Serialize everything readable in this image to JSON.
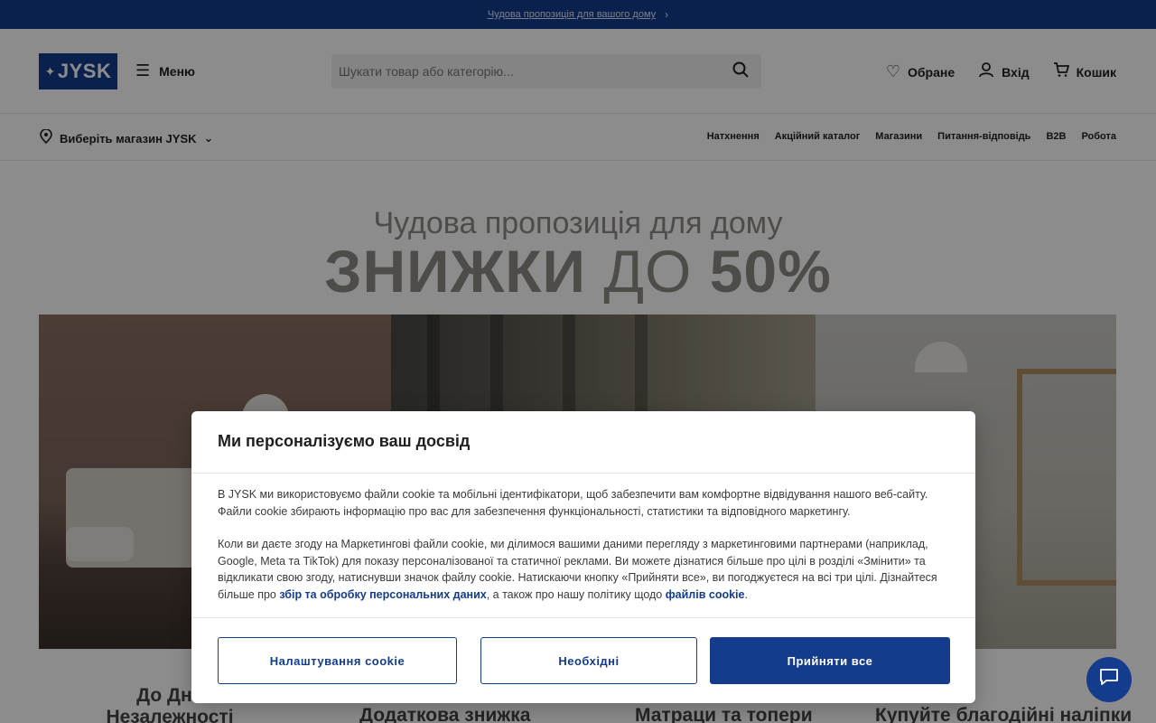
{
  "promo_bar": {
    "text": "Чудова пропозиція для вашого дому",
    "chevron": "chevron-right-icon"
  },
  "header": {
    "logo": "JYSK",
    "menu_label": "Меню",
    "search_placeholder": "Шукати товар або категорію...",
    "favorites_label": "Обране",
    "login_label": "Вхід",
    "cart_label": "Кошик"
  },
  "subnav": {
    "store_label": "Виберіть магазин JYSK",
    "links": [
      "Натхнення",
      "Акційний каталог",
      "Магазини",
      "Питання-відповідь",
      "B2B",
      "Робота"
    ]
  },
  "hero": {
    "title": "Чудова пропозиція для дому",
    "sale_bold": "ЗНИЖКИ",
    "sale_light": "ДО",
    "sale_value": "50%"
  },
  "cards": [
    "До Дня Незалежності України",
    "Додаткова знижка",
    "Матраци та топери",
    "Купуйте благодійні наліпки"
  ],
  "cookie_modal": {
    "title": "Ми персоналізуємо ваш досвід",
    "para1": "В JYSK ми використовуємо файли cookie та мобільні ідентифікатори, щоб забезпечити вам комфортне відвідування нашого веб-сайту. Файли cookie збирають інформацію про вас для забезпечення функціональності, статистики та відповідного маркетингу.",
    "para2_text": "Коли ви даєте згоду на Маркетингові файли cookie, ми ділимося вашими даними перегляду з маркетинговими партнерами (наприклад, Google, Meta та TikTok) для показу персоналізованої та статичної реклами. Ви можете дізнатися більше про цілі в розділі «Змінити» та відкликати свою згоду, натиснувши значок файлу cookie. Натискаючи кнопку «Прийняти все», ви погоджуєтеся на всі три цілі. Дізнайтеся більше про ",
    "link1": "збір та обробку персональних даних",
    "para2_mid": ", а також про нашу політику щодо ",
    "link2": "файлів cookie",
    "para2_end": ".",
    "btn_settings": "Налаштування cookie",
    "btn_necessary": "Необхідні",
    "btn_accept": "Прийняти все"
  },
  "colors": {
    "brand": "#143c8c",
    "overlay": "rgba(0,0,0,0.45)"
  }
}
